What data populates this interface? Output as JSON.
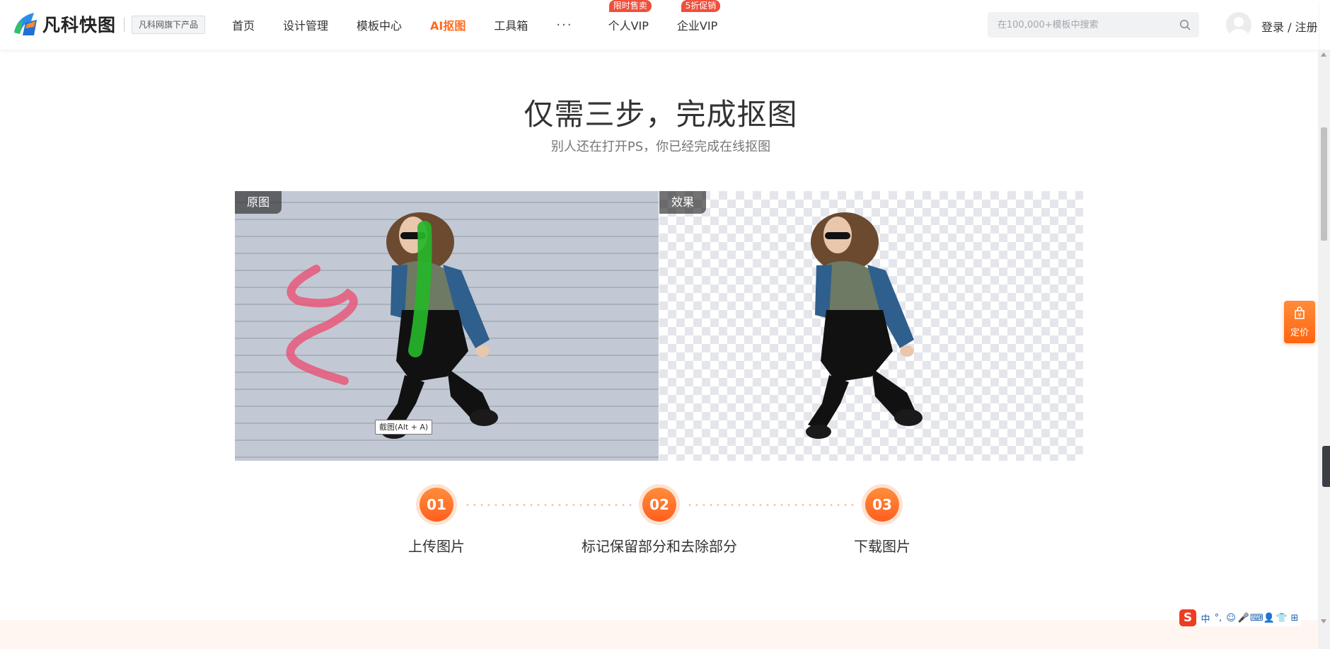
{
  "header": {
    "logo_text": "凡科快图",
    "logo_badge": "凡科网旗下产品",
    "nav": [
      {
        "label": "首页"
      },
      {
        "label": "设计管理"
      },
      {
        "label": "模板中心"
      },
      {
        "label": "AI抠图",
        "active": true
      },
      {
        "label": "工具箱"
      },
      {
        "label": "···"
      },
      {
        "label": "个人VIP",
        "tag": "限时售卖"
      },
      {
        "label": "企业VIP",
        "tag": "5折促销"
      }
    ],
    "search_placeholder": "在100,000+模板中搜索",
    "login_text": "登录 / 注册"
  },
  "main": {
    "title": "仅需三步，完成抠图",
    "subtitle": "别人还在打开PS，你已经完成在线抠图",
    "left_label": "原图",
    "right_label": "效果",
    "tooltip": "截图(Alt + A)",
    "steps": [
      {
        "number": "01",
        "label": "上传图片"
      },
      {
        "number": "02",
        "label": "标记保留部分和去除部分"
      },
      {
        "number": "03",
        "label": "下载图片"
      }
    ]
  },
  "side": {
    "price_label": "定价"
  },
  "ime": {
    "logo": "S",
    "items": [
      "中",
      "°,",
      "☺",
      "🎤",
      "⌨",
      "👤",
      "👕",
      "⊞"
    ]
  },
  "colors": {
    "accent": "#ff6a1a",
    "tag_red": "#f04f3c",
    "keep_marker": "#26b52a",
    "remove_marker": "#e8587a"
  }
}
